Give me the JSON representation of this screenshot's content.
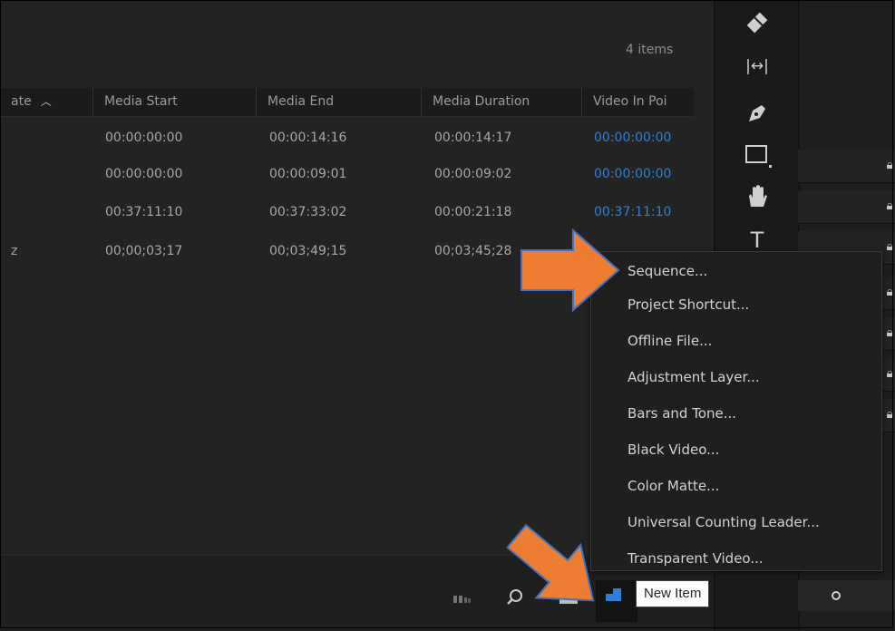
{
  "panel": {
    "item_count": "4 items"
  },
  "columns": [
    {
      "label": "ate"
    },
    {
      "label": "Media Start"
    },
    {
      "label": "Media End"
    },
    {
      "label": "Media Duration"
    },
    {
      "label": "Video In Poi"
    }
  ],
  "sort_icon": "^",
  "rows": [
    {
      "name": "",
      "media_start": "00:00:00:00",
      "media_end": "00:00:14:16",
      "media_duration": "00:00:14:17",
      "video_in": "00:00:00:00"
    },
    {
      "name": "",
      "media_start": "00:00:00:00",
      "media_end": "00:00:09:01",
      "media_duration": "00:00:09:02",
      "video_in": "00:00:00:00"
    },
    {
      "name": "",
      "media_start": "00:37:11:10",
      "media_end": "00:37:33:02",
      "media_duration": "00:00:21:18",
      "video_in": "00:37:11:10"
    },
    {
      "name": "z",
      "media_start": "00;00;03;17",
      "media_end": "00;03;49;15",
      "media_duration": "00;03;45;28",
      "video_in": ""
    }
  ],
  "tools": [
    "track-select-icon",
    "ripple-edit-icon",
    "pen-icon",
    "rectangle-icon",
    "hand-icon",
    "type-icon"
  ],
  "tools_glyphs": {
    "ripple": "|↔|",
    "type": "T"
  },
  "new_item_menu": {
    "items": [
      "Sequence...",
      "Project Shortcut...",
      "Offline File...",
      "Adjustment Layer...",
      "Bars and Tone...",
      "Black Video...",
      "Color Matte...",
      "Universal Counting Leader...",
      "Transparent Video..."
    ]
  },
  "tooltip": "New Item",
  "colors": {
    "accent_blue": "#2f7fd8",
    "arrow_orange": "#ed7d31",
    "arrow_outline": "#4472c4"
  }
}
